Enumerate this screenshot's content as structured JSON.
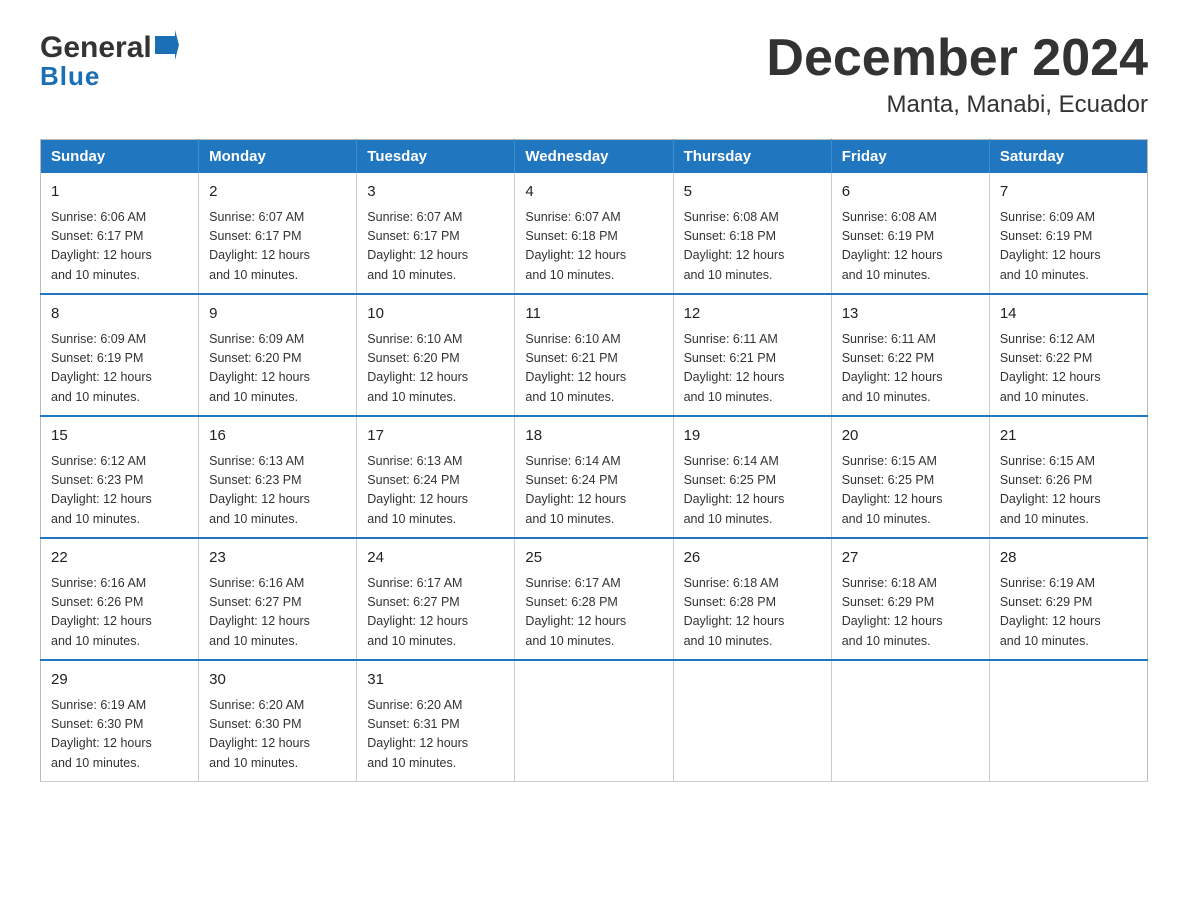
{
  "header": {
    "logo_general": "General",
    "logo_blue": "Blue",
    "title": "December 2024",
    "subtitle": "Manta, Manabi, Ecuador"
  },
  "days_of_week": [
    "Sunday",
    "Monday",
    "Tuesday",
    "Wednesday",
    "Thursday",
    "Friday",
    "Saturday"
  ],
  "weeks": [
    [
      {
        "day": "1",
        "sunrise": "6:06 AM",
        "sunset": "6:17 PM",
        "daylight": "12 hours and 10 minutes."
      },
      {
        "day": "2",
        "sunrise": "6:07 AM",
        "sunset": "6:17 PM",
        "daylight": "12 hours and 10 minutes."
      },
      {
        "day": "3",
        "sunrise": "6:07 AM",
        "sunset": "6:17 PM",
        "daylight": "12 hours and 10 minutes."
      },
      {
        "day": "4",
        "sunrise": "6:07 AM",
        "sunset": "6:18 PM",
        "daylight": "12 hours and 10 minutes."
      },
      {
        "day": "5",
        "sunrise": "6:08 AM",
        "sunset": "6:18 PM",
        "daylight": "12 hours and 10 minutes."
      },
      {
        "day": "6",
        "sunrise": "6:08 AM",
        "sunset": "6:19 PM",
        "daylight": "12 hours and 10 minutes."
      },
      {
        "day": "7",
        "sunrise": "6:09 AM",
        "sunset": "6:19 PM",
        "daylight": "12 hours and 10 minutes."
      }
    ],
    [
      {
        "day": "8",
        "sunrise": "6:09 AM",
        "sunset": "6:19 PM",
        "daylight": "12 hours and 10 minutes."
      },
      {
        "day": "9",
        "sunrise": "6:09 AM",
        "sunset": "6:20 PM",
        "daylight": "12 hours and 10 minutes."
      },
      {
        "day": "10",
        "sunrise": "6:10 AM",
        "sunset": "6:20 PM",
        "daylight": "12 hours and 10 minutes."
      },
      {
        "day": "11",
        "sunrise": "6:10 AM",
        "sunset": "6:21 PM",
        "daylight": "12 hours and 10 minutes."
      },
      {
        "day": "12",
        "sunrise": "6:11 AM",
        "sunset": "6:21 PM",
        "daylight": "12 hours and 10 minutes."
      },
      {
        "day": "13",
        "sunrise": "6:11 AM",
        "sunset": "6:22 PM",
        "daylight": "12 hours and 10 minutes."
      },
      {
        "day": "14",
        "sunrise": "6:12 AM",
        "sunset": "6:22 PM",
        "daylight": "12 hours and 10 minutes."
      }
    ],
    [
      {
        "day": "15",
        "sunrise": "6:12 AM",
        "sunset": "6:23 PM",
        "daylight": "12 hours and 10 minutes."
      },
      {
        "day": "16",
        "sunrise": "6:13 AM",
        "sunset": "6:23 PM",
        "daylight": "12 hours and 10 minutes."
      },
      {
        "day": "17",
        "sunrise": "6:13 AM",
        "sunset": "6:24 PM",
        "daylight": "12 hours and 10 minutes."
      },
      {
        "day": "18",
        "sunrise": "6:14 AM",
        "sunset": "6:24 PM",
        "daylight": "12 hours and 10 minutes."
      },
      {
        "day": "19",
        "sunrise": "6:14 AM",
        "sunset": "6:25 PM",
        "daylight": "12 hours and 10 minutes."
      },
      {
        "day": "20",
        "sunrise": "6:15 AM",
        "sunset": "6:25 PM",
        "daylight": "12 hours and 10 minutes."
      },
      {
        "day": "21",
        "sunrise": "6:15 AM",
        "sunset": "6:26 PM",
        "daylight": "12 hours and 10 minutes."
      }
    ],
    [
      {
        "day": "22",
        "sunrise": "6:16 AM",
        "sunset": "6:26 PM",
        "daylight": "12 hours and 10 minutes."
      },
      {
        "day": "23",
        "sunrise": "6:16 AM",
        "sunset": "6:27 PM",
        "daylight": "12 hours and 10 minutes."
      },
      {
        "day": "24",
        "sunrise": "6:17 AM",
        "sunset": "6:27 PM",
        "daylight": "12 hours and 10 minutes."
      },
      {
        "day": "25",
        "sunrise": "6:17 AM",
        "sunset": "6:28 PM",
        "daylight": "12 hours and 10 minutes."
      },
      {
        "day": "26",
        "sunrise": "6:18 AM",
        "sunset": "6:28 PM",
        "daylight": "12 hours and 10 minutes."
      },
      {
        "day": "27",
        "sunrise": "6:18 AM",
        "sunset": "6:29 PM",
        "daylight": "12 hours and 10 minutes."
      },
      {
        "day": "28",
        "sunrise": "6:19 AM",
        "sunset": "6:29 PM",
        "daylight": "12 hours and 10 minutes."
      }
    ],
    [
      {
        "day": "29",
        "sunrise": "6:19 AM",
        "sunset": "6:30 PM",
        "daylight": "12 hours and 10 minutes."
      },
      {
        "day": "30",
        "sunrise": "6:20 AM",
        "sunset": "6:30 PM",
        "daylight": "12 hours and 10 minutes."
      },
      {
        "day": "31",
        "sunrise": "6:20 AM",
        "sunset": "6:31 PM",
        "daylight": "12 hours and 10 minutes."
      },
      null,
      null,
      null,
      null
    ]
  ],
  "labels": {
    "sunrise": "Sunrise:",
    "sunset": "Sunset:",
    "daylight": "Daylight:"
  }
}
